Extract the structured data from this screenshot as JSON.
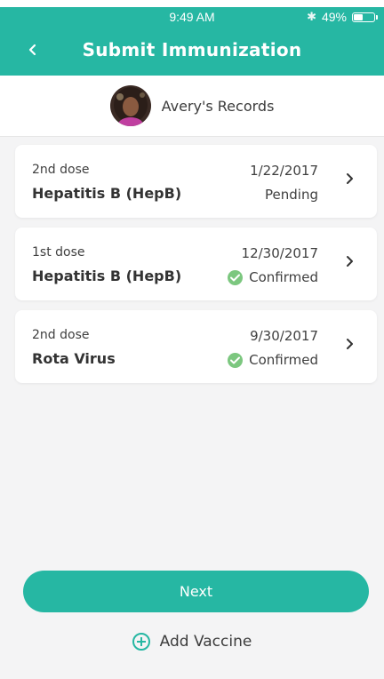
{
  "status_bar": {
    "time": "9:49 AM",
    "battery_text": "49%",
    "battery_level": 0.49,
    "bluetooth_icon": "bluetooth-icon"
  },
  "header": {
    "title": "Submit Immunization",
    "back_icon": "chevron-left-icon"
  },
  "profile": {
    "name": "Avery's Records"
  },
  "records": [
    {
      "dose": "2nd dose",
      "vaccine": "Hepatitis B (HepB)",
      "date": "1/22/2017",
      "status": "Pending",
      "confirmed": false
    },
    {
      "dose": "1st dose",
      "vaccine": "Hepatitis B (HepB)",
      "date": "12/30/2017",
      "status": "Confirmed",
      "confirmed": true
    },
    {
      "dose": "2nd dose",
      "vaccine": "Rota Virus",
      "date": "9/30/2017",
      "status": "Confirmed",
      "confirmed": true
    }
  ],
  "actions": {
    "next_label": "Next",
    "add_vaccine_label": "Add Vaccine"
  },
  "colors": {
    "accent": "#26b7a3",
    "confirmed": "#7cc77f",
    "background": "#f4f4f5"
  }
}
